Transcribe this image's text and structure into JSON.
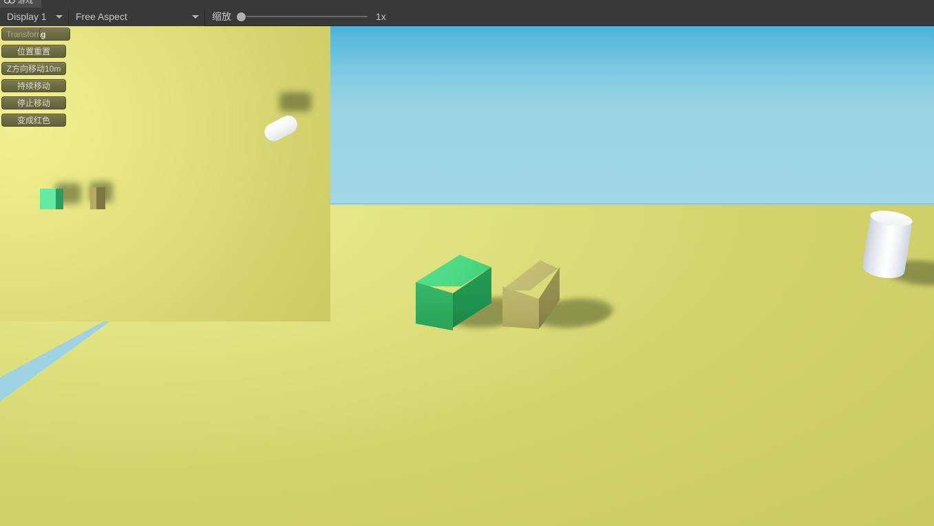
{
  "window": {
    "tab_label": "游戏",
    "tab_icon": "game-controller-icon"
  },
  "toolbar": {
    "display_value": "Display 1",
    "display_caret_icon": "chevron-down-icon",
    "aspect_value": "Free Aspect",
    "aspect_caret_icon": "chevron-down-icon",
    "zoom_label": "缩放",
    "zoom_value": "1x",
    "zoom_slider_position_percent": 0
  },
  "gui_overlay": {
    "buttons": [
      {
        "label": "Transform",
        "name": "transform-button"
      },
      {
        "label": "Tag",
        "name": "tag-button"
      },
      {
        "label": "位置重置",
        "name": "reset-position-button"
      },
      {
        "label": "Z方向移动10m",
        "name": "move-z-10m-button"
      },
      {
        "label": "持续移动",
        "name": "continuous-move-button"
      },
      {
        "label": "停止移动",
        "name": "stop-move-button"
      },
      {
        "label": "变成红色",
        "name": "turn-red-button"
      }
    ]
  },
  "scene": {
    "main_view": {
      "sky_color_top": "#4bb3da",
      "sky_color_bottom": "#a2d7e6",
      "ground_color": "#d4d46f",
      "objects": [
        {
          "name": "green-cube",
          "color": "#3cc97a"
        },
        {
          "name": "tan-cube",
          "color": "#b6b067"
        },
        {
          "name": "white-cylinder",
          "color": "#ffffff"
        }
      ]
    },
    "inset_view": {
      "ground_color": "#dcda78",
      "objects": [
        {
          "name": "white-capsule",
          "color": "#ffffff"
        },
        {
          "name": "green-cube",
          "color": "#64eba2"
        },
        {
          "name": "tan-cube",
          "color": "#b5ab63"
        }
      ]
    }
  }
}
